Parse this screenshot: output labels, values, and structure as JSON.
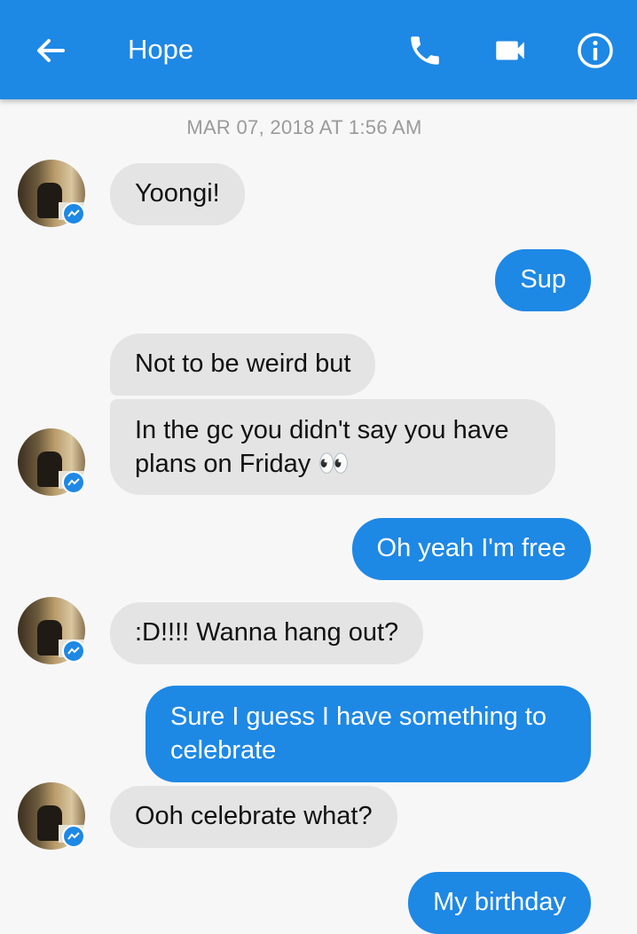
{
  "header": {
    "title": "Hope",
    "icons": [
      "back-arrow-icon",
      "phone-icon",
      "video-camera-icon",
      "info-icon"
    ]
  },
  "timestamp": "MAR 07, 2018 AT 1:56 AM",
  "messages": [
    {
      "from": "them",
      "text": "Yoongi!"
    },
    {
      "from": "me",
      "text": "Sup"
    },
    {
      "from": "them",
      "text": "Not to be weird but"
    },
    {
      "from": "them",
      "text": "In the gc you didn't say you have plans on Friday 👀"
    },
    {
      "from": "me",
      "text": "Oh yeah I'm free"
    },
    {
      "from": "them",
      "text": ":D!!!! Wanna hang out?"
    },
    {
      "from": "me",
      "text": "Sure I guess I have something to celebrate"
    },
    {
      "from": "them",
      "text": "Ooh celebrate what?"
    },
    {
      "from": "me",
      "text": "My birthday"
    }
  ],
  "colors": {
    "accent": "#1e88e5",
    "incoming_bubble": "#e4e4e4",
    "background": "#f7f7f7"
  }
}
